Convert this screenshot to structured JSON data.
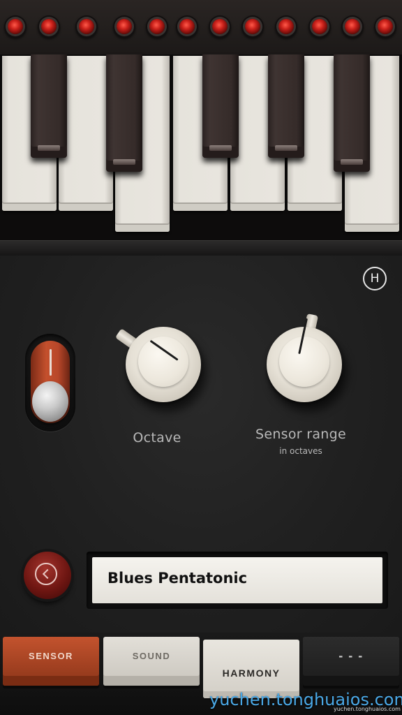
{
  "leds": {
    "count": 12,
    "color": "#d0231b"
  },
  "keyboard": {
    "white_keys": 7,
    "black_keys": 5
  },
  "help": {
    "label": "H"
  },
  "controls": {
    "toggle": {
      "state": "on",
      "color": "#c4502d"
    },
    "octave": {
      "label": "Octave",
      "pointer_angle_deg": -55
    },
    "sensor_range": {
      "label": "Sensor range",
      "sublabel": "in octaves",
      "pointer_angle_deg": 12
    }
  },
  "scale_display": {
    "value": "Blues Pentatonic"
  },
  "tabs": [
    {
      "label": "SENSOR",
      "active": false
    },
    {
      "label": "SOUND",
      "active": false
    },
    {
      "label": "HARMONY",
      "active": true
    },
    {
      "label": "- - -",
      "active": false
    }
  ],
  "watermark": {
    "text": "yuchen.tonghuaios.com",
    "small": "yuchen.tonghuaios.com"
  }
}
